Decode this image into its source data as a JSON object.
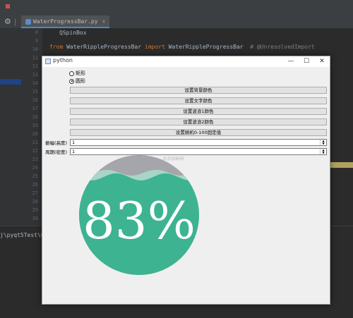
{
  "ide": {
    "tab_label": "WaterProgressBar.py",
    "line_numbers": [
      "8",
      "9",
      "10",
      "11",
      "12",
      "13",
      "14",
      "15",
      "16",
      "17",
      "18",
      "19",
      "20",
      "21",
      "22",
      "23",
      "24",
      "25",
      "26",
      "27",
      "28",
      "29",
      "30"
    ],
    "code_line_top": "QSpinBox",
    "code_line_import": {
      "from": "from",
      "module": "WaterRippleProgressBar",
      "import": "import",
      "name": "WaterRippleProgressBar",
      "comment": "# @UnresolvedImport"
    },
    "terminal_path": "j\\pyqt5Test\\6."
  },
  "window": {
    "title": "python",
    "minimize": "—",
    "maximize": "☐",
    "close": "✕"
  },
  "radios": [
    {
      "label": "矩形",
      "checked": false
    },
    {
      "label": "圆形",
      "checked": true
    }
  ],
  "buttons": [
    "设置背景颜色",
    "设置文字颜色",
    "设置波浪1颜色",
    "设置波浪2颜色",
    "设置随机0-100固定值"
  ],
  "spins": [
    {
      "label": "振幅(高度)",
      "value": "1"
    },
    {
      "label": "周期(密度)",
      "value": "1"
    }
  ],
  "watermark": "北京创新网",
  "progress": {
    "value": 83,
    "text": "83%",
    "wave1_color": "#3db391",
    "wave2_color": "#a8d5c6",
    "background_color": "#a4a6ab",
    "text_color": "#ffffff"
  },
  "colors": {
    "ide_bg": "#2b2b2b",
    "window_bg": "#f0eff0"
  }
}
